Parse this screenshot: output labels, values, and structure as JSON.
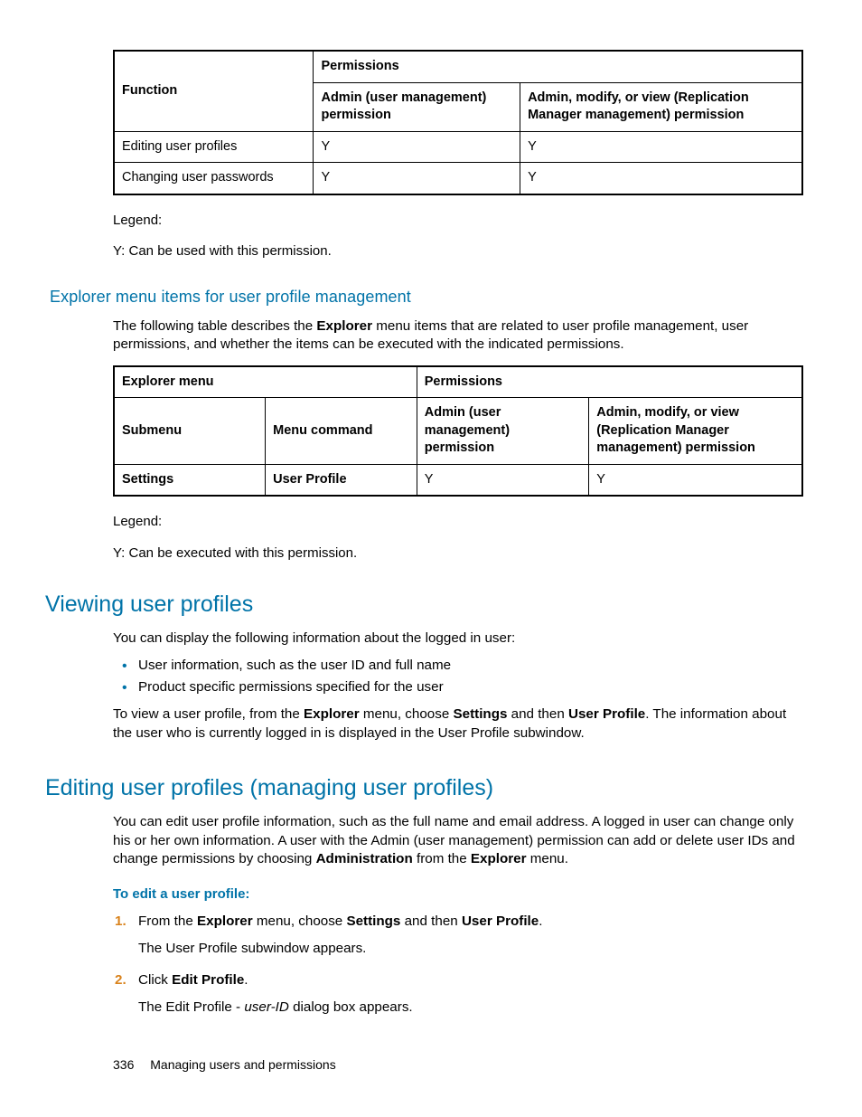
{
  "table1": {
    "headers": {
      "function": "Function",
      "permissions": "Permissions",
      "col_a": "Admin (user management) permission",
      "col_b": "Admin, modify, or view (Replication Manager management) permission"
    },
    "rows": [
      {
        "fn": "Editing user profiles",
        "a": "Y",
        "b": "Y"
      },
      {
        "fn": "Changing user passwords",
        "a": "Y",
        "b": "Y"
      }
    ]
  },
  "legend1": {
    "l1": "Legend:",
    "l2": "Y: Can be used with this permission."
  },
  "h2_explorer": "Explorer menu items for user profile management",
  "p_explorer_intro_1": "The following table describes the ",
  "p_explorer_intro_bold": "Explorer",
  "p_explorer_intro_2": " menu items that are related to user profile management, user permissions, and whether the items can be executed with the indicated permissions.",
  "table2": {
    "headers": {
      "explorer_menu": "Explorer menu",
      "permissions": "Permissions",
      "submenu": "Submenu",
      "menu_command": "Menu command",
      "col_a": "Admin (user management) permission",
      "col_b": "Admin, modify, or view (Replication Manager management) permission"
    },
    "rows": [
      {
        "submenu": "Settings",
        "cmd": "User Profile",
        "a": "Y",
        "b": "Y"
      }
    ]
  },
  "legend2": {
    "l1": "Legend:",
    "l2": "Y: Can be executed with this permission."
  },
  "h1_viewing": "Viewing user profiles",
  "p_viewing_intro": "You can display the following information about the logged in user:",
  "viewing_bullets": [
    "User information, such as the user ID and full name",
    "Product specific permissions specified for the user"
  ],
  "p_viewing_howto_1": "To view a user profile, from the ",
  "p_viewing_howto_b1": "Explorer",
  "p_viewing_howto_2": " menu, choose ",
  "p_viewing_howto_b2": "Settings",
  "p_viewing_howto_3": " and then ",
  "p_viewing_howto_b3": "User Profile",
  "p_viewing_howto_4": ". The information about the user who is currently logged in is displayed in the User Profile subwindow.",
  "h1_editing": "Editing user profiles (managing user profiles)",
  "p_editing_intro_1": "You can edit user profile information, such as the full name and email address. A logged in user can change only his or her own information. A user with the Admin (user management) permission can add or delete user IDs and change permissions by choosing ",
  "p_editing_intro_b1": "Administration",
  "p_editing_intro_2": " from the ",
  "p_editing_intro_b2": "Explorer",
  "p_editing_intro_3": " menu.",
  "proc_title": "To edit a user profile:",
  "step1_1": "From the ",
  "step1_b1": "Explorer",
  "step1_2": " menu, choose ",
  "step1_b2": "Settings",
  "step1_3": " and then ",
  "step1_b3": "User Profile",
  "step1_4": ".",
  "step1_sub": "The User Profile subwindow appears.",
  "step2_1": "Click ",
  "step2_b1": "Edit Profile",
  "step2_2": ".",
  "step2_sub_1": "The Edit Profile - ",
  "step2_sub_i": "user-ID",
  "step2_sub_2": " dialog box appears.",
  "footer": {
    "page": "336",
    "title": "Managing users and permissions"
  }
}
